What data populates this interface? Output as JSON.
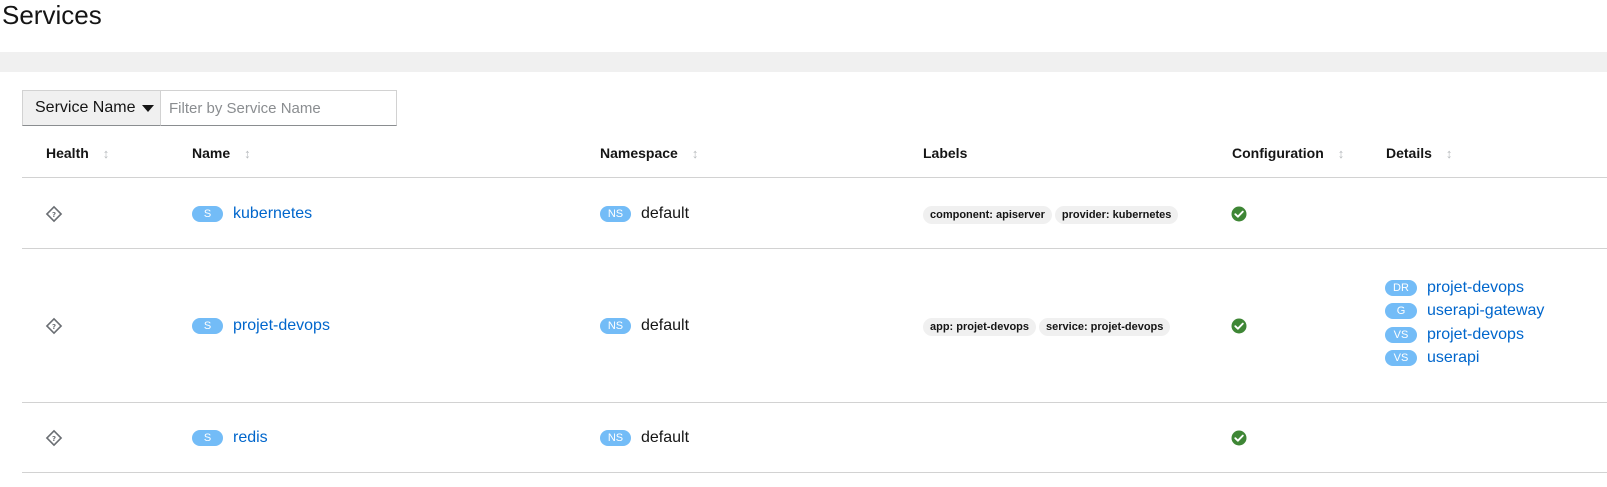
{
  "page": {
    "title": "Services"
  },
  "filter": {
    "select_label": "Service Name",
    "placeholder": "Filter by Service Name",
    "value": ""
  },
  "table": {
    "columns": [
      "Health",
      "Name",
      "Namespace",
      "Labels",
      "Configuration",
      "Details"
    ],
    "rows": [
      {
        "name_badge": "S",
        "name": "kubernetes",
        "ns_badge": "NS",
        "namespace": "default",
        "labels": [
          "component: apiserver",
          "provider: kubernetes"
        ],
        "details": []
      },
      {
        "name_badge": "S",
        "name": "projet-devops",
        "ns_badge": "NS",
        "namespace": "default",
        "labels": [
          "app: projet-devops",
          "service: projet-devops"
        ],
        "details": [
          {
            "badge": "DR",
            "text": "projet-devops"
          },
          {
            "badge": "G",
            "text": "userapi-gateway"
          },
          {
            "badge": "VS",
            "text": "projet-devops"
          },
          {
            "badge": "VS",
            "text": "userapi"
          }
        ]
      },
      {
        "name_badge": "S",
        "name": "redis",
        "ns_badge": "NS",
        "namespace": "default",
        "labels": [],
        "details": []
      }
    ]
  },
  "icons": {
    "health": "unknown-health-icon",
    "configuration": "valid-check-icon",
    "sort": "sort-arrows-icon"
  },
  "colors": {
    "link": "#0066cc",
    "badge": "#73bcf7",
    "valid": "#3e8635",
    "chip_bg": "#f0f0f0"
  }
}
